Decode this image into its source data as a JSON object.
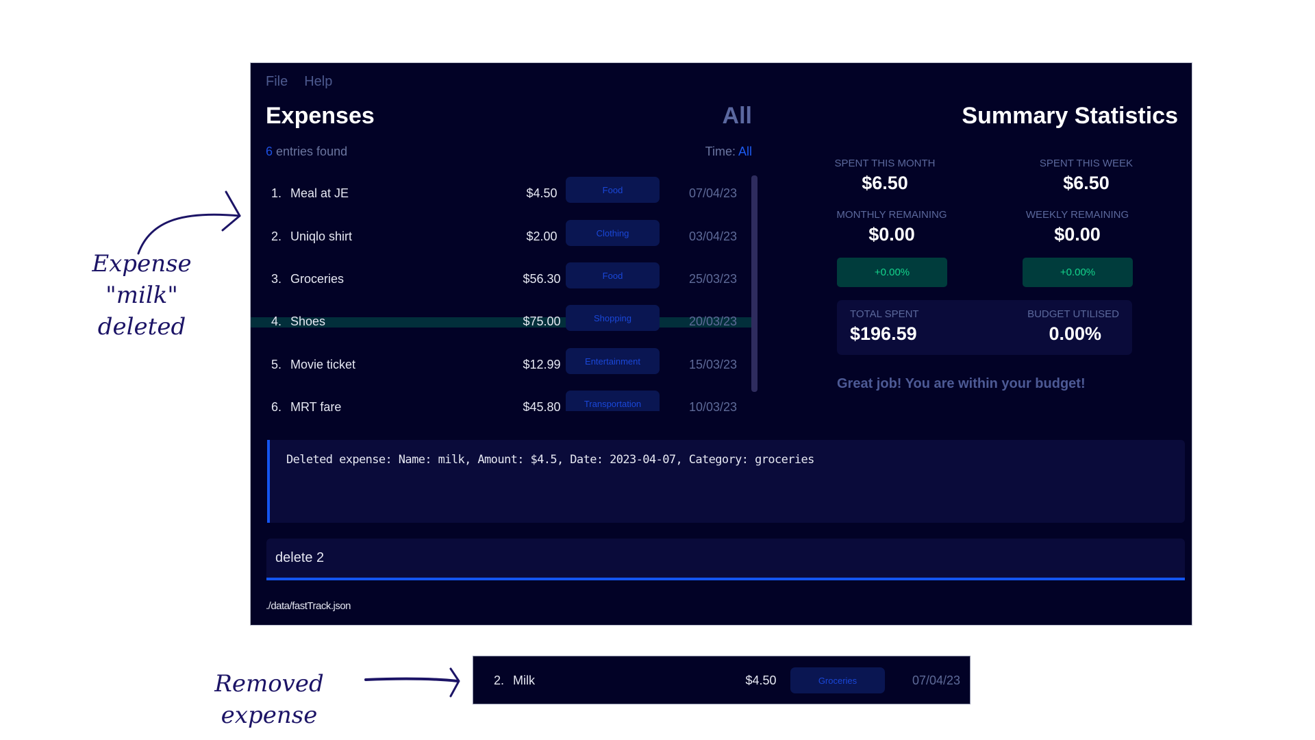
{
  "menu": {
    "items": [
      "File",
      "Help"
    ]
  },
  "expenses": {
    "title": "Expenses",
    "filter_label": "All",
    "entries_count": "6",
    "entries_suffix": "entries found",
    "time_label": "Time:",
    "time_value": "All",
    "rows": [
      {
        "index": "1.",
        "name": "Meal at JE",
        "amount": "$4.50",
        "category": "Food",
        "date": "07/04/23"
      },
      {
        "index": "2.",
        "name": "Uniqlo shirt",
        "amount": "$2.00",
        "category": "Clothing",
        "date": "03/04/23"
      },
      {
        "index": "3.",
        "name": "Groceries",
        "amount": "$56.30",
        "category": "Food",
        "date": "25/03/23"
      },
      {
        "index": "4.",
        "name": "Shoes",
        "amount": "$75.00",
        "category": "Shopping",
        "date": "20/03/23"
      },
      {
        "index": "5.",
        "name": "Movie ticket",
        "amount": "$12.99",
        "category": "Entertainment",
        "date": "15/03/23"
      },
      {
        "index": "6.",
        "name": "MRT fare",
        "amount": "$45.80",
        "category": "Transportation",
        "date": "10/03/23"
      }
    ]
  },
  "summary": {
    "title": "Summary Statistics",
    "spent_month_label": "SPENT THIS MONTH",
    "spent_month_value": "$6.50",
    "spent_week_label": "SPENT THIS WEEK",
    "spent_week_value": "$6.50",
    "monthly_remaining_label": "MONTHLY REMAINING",
    "monthly_remaining_value": "$0.00",
    "weekly_remaining_label": "WEEKLY REMAINING",
    "weekly_remaining_value": "$0.00",
    "monthly_change": "+0.00%",
    "weekly_change": "+0.00%",
    "total_spent_label": "TOTAL SPENT",
    "total_spent_value": "$196.59",
    "budget_utilised_label": "BUDGET UTILISED",
    "budget_utilised_value": "0.00%",
    "message": "Great job! You are within your budget!"
  },
  "result_display": {
    "text": "Deleted expense: Name: milk, Amount: $4.5, Date: 2023-04-07, Category: groceries"
  },
  "command_box": {
    "value": "delete 2"
  },
  "status_bar": {
    "path": "./data/fastTrack.json"
  },
  "removed_expense": {
    "index": "2.",
    "name": "Milk",
    "amount": "$4.50",
    "category": "Groceries",
    "date": "07/04/23"
  },
  "annotations": {
    "deleted_note_line1": "Expense \"milk\"",
    "deleted_note_line2": "deleted",
    "removed_note": "Removed expense"
  },
  "colors": {
    "background": "#020226",
    "accent_blue": "#1455f0",
    "positive_green": "#14d38b",
    "selected_row": "#022f3b",
    "annotation_ink": "#1c1466"
  }
}
